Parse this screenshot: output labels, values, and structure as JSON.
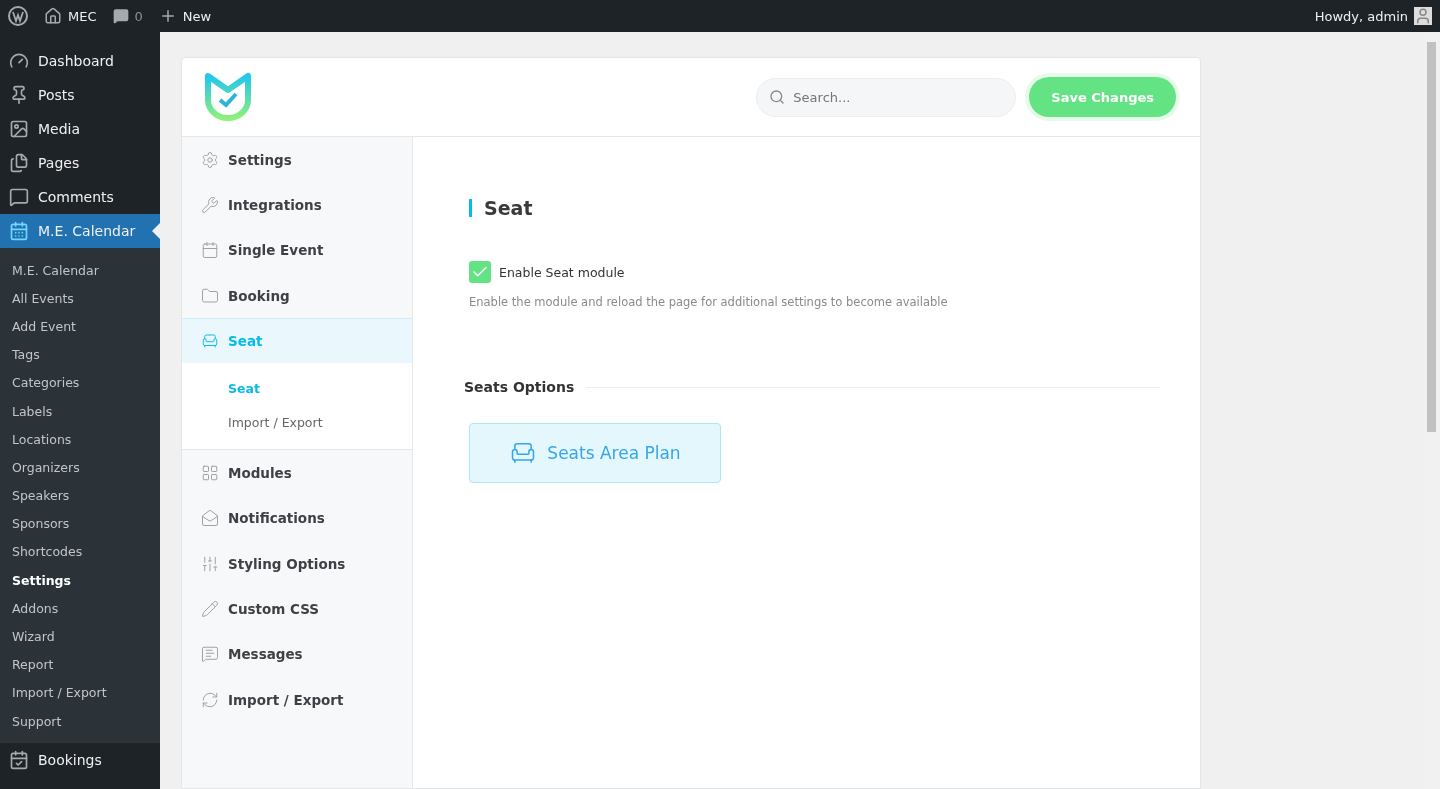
{
  "admin_bar": {
    "site": "MEC",
    "comments": "0",
    "new": "New",
    "greeting": "Howdy, admin"
  },
  "wp_menu": [
    {
      "label": "Dashboard",
      "selected": false
    },
    {
      "label": "Posts",
      "selected": false
    },
    {
      "label": "Media",
      "selected": false
    },
    {
      "label": "Pages",
      "selected": false
    },
    {
      "label": "Comments",
      "selected": false
    },
    {
      "label": "M.E. Calendar",
      "selected": true,
      "children": [
        {
          "label": "M.E. Calendar",
          "selected": false
        },
        {
          "label": "All Events",
          "selected": false
        },
        {
          "label": "Add Event",
          "selected": false
        },
        {
          "label": "Tags",
          "selected": false
        },
        {
          "label": "Categories",
          "selected": false
        },
        {
          "label": "Labels",
          "selected": false
        },
        {
          "label": "Locations",
          "selected": false
        },
        {
          "label": "Organizers",
          "selected": false
        },
        {
          "label": "Speakers",
          "selected": false
        },
        {
          "label": "Sponsors",
          "selected": false
        },
        {
          "label": "Shortcodes",
          "selected": false
        },
        {
          "label": "Settings",
          "selected": true
        },
        {
          "label": "Addons",
          "selected": false
        },
        {
          "label": "Wizard",
          "selected": false
        },
        {
          "label": "Report",
          "selected": false
        },
        {
          "label": "Import / Export",
          "selected": false
        },
        {
          "label": "Support",
          "selected": false
        }
      ]
    },
    {
      "label": "Bookings",
      "selected": false
    }
  ],
  "header": {
    "search_placeholder": "Search...",
    "save": "Save Changes"
  },
  "settings_nav": [
    {
      "label": "Settings",
      "selected": false
    },
    {
      "label": "Integrations",
      "selected": false
    },
    {
      "label": "Single Event",
      "selected": false
    },
    {
      "label": "Booking",
      "selected": false
    },
    {
      "label": "Seat",
      "selected": true,
      "expanded": true,
      "children": [
        {
          "label": "Seat",
          "selected": true
        },
        {
          "label": "Import / Export",
          "selected": false
        }
      ]
    },
    {
      "label": "Modules",
      "selected": false
    },
    {
      "label": "Notifications",
      "selected": false
    },
    {
      "label": "Styling Options",
      "selected": false
    },
    {
      "label": "Custom CSS",
      "selected": false
    },
    {
      "label": "Messages",
      "selected": false
    },
    {
      "label": "Import / Export",
      "selected": false
    }
  ],
  "content": {
    "title": "Seat",
    "option": {
      "label": "Enable Seat module",
      "checked": true
    },
    "description": "Enable the module and reload the page for additional settings to become available",
    "section": "Seats Options",
    "plan_button": "Seats Area Plan"
  }
}
